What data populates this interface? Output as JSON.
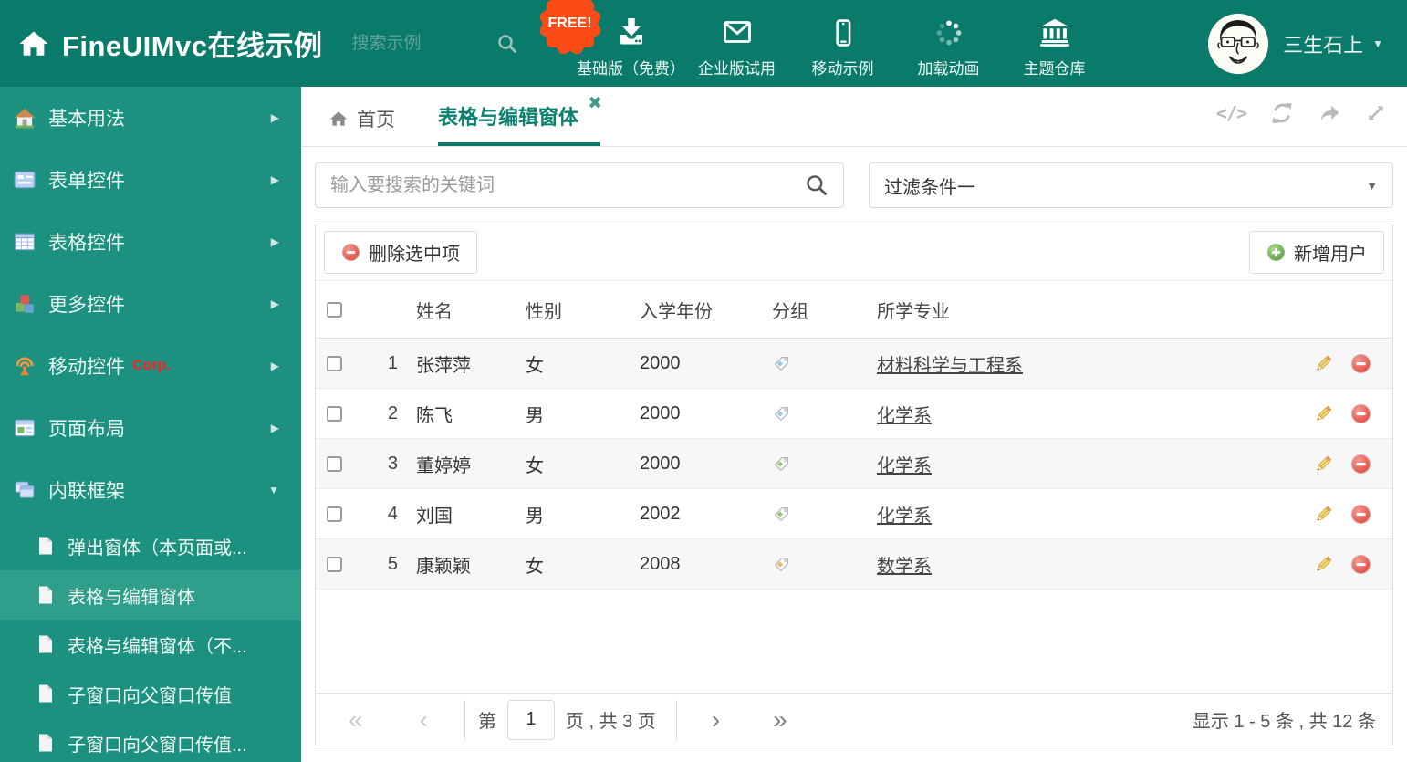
{
  "header": {
    "title": "FineUIMvc在线示例",
    "search_placeholder": "搜索示例",
    "free_badge": "FREE!",
    "nav": [
      {
        "label": "基础版（免费）",
        "icon": "download-icon"
      },
      {
        "label": "企业版试用",
        "icon": "envelope-icon"
      },
      {
        "label": "移动示例",
        "icon": "mobile-icon"
      },
      {
        "label": "加载动画",
        "icon": "spinner-icon"
      },
      {
        "label": "主题仓库",
        "icon": "bank-icon"
      }
    ],
    "user_name": "三生石上"
  },
  "sidebar": {
    "items": [
      {
        "label": "基本用法"
      },
      {
        "label": "表单控件"
      },
      {
        "label": "表格控件"
      },
      {
        "label": "更多控件"
      },
      {
        "label": "移动控件",
        "badge": "Corp."
      },
      {
        "label": "页面布局"
      },
      {
        "label": "内联框架"
      }
    ],
    "subitems": [
      {
        "label": "弹出窗体（本页面或...",
        "active": false
      },
      {
        "label": "表格与编辑窗体",
        "active": true
      },
      {
        "label": "表格与编辑窗体（不...",
        "active": false
      },
      {
        "label": "子窗口向父窗口传值",
        "active": false
      },
      {
        "label": "子窗口向父窗口传值...",
        "active": false
      }
    ]
  },
  "tabs": {
    "home_label": "首页",
    "active_label": "表格与编辑窗体"
  },
  "filter_bar": {
    "search_placeholder": "输入要搜索的关键词",
    "filter_selected": "过滤条件一"
  },
  "panel_toolbar": {
    "delete_selected_label": "删除选中项",
    "add_user_label": "新增用户"
  },
  "table": {
    "columns": {
      "name": "姓名",
      "gender": "性别",
      "year": "入学年份",
      "group": "分组",
      "major": "所学专业"
    },
    "rows": [
      {
        "num": "1",
        "name": "张萍萍",
        "gender": "女",
        "year": "2000",
        "tag_color": "#8cc8f0",
        "major": "材料科学与工程系"
      },
      {
        "num": "2",
        "name": "陈飞",
        "gender": "男",
        "year": "2000",
        "tag_color": "#8cc8f0",
        "major": "化学系"
      },
      {
        "num": "3",
        "name": "董婷婷",
        "gender": "女",
        "year": "2000",
        "tag_color": "#97c96e",
        "major": "化学系"
      },
      {
        "num": "4",
        "name": "刘国",
        "gender": "男",
        "year": "2002",
        "tag_color": "#97c96e",
        "major": "化学系"
      },
      {
        "num": "5",
        "name": "康颖颖",
        "gender": "女",
        "year": "2008",
        "tag_color": "#f6b26f",
        "major": "数学系"
      }
    ]
  },
  "pagination": {
    "first": "«",
    "prev": "‹",
    "next": "›",
    "last": "»",
    "prefix": "第",
    "page_value": "1",
    "suffix": "页 , 共 3 页",
    "summary": "显示 1 - 5 条 , 共 12 条"
  },
  "colors": {
    "header_bg": "#0a7b6b",
    "sidebar_bg": "#1d9180",
    "sidebar_active_bg": "#2f9e8b",
    "accent_teal": "#0d8070",
    "free_badge_bg": "#fb4b17",
    "corp_badge": "#ff1f1f",
    "tag_blue": "#8cc8f0",
    "tag_green": "#97c96e",
    "tag_orange": "#f6b26f",
    "delete_red": "#e04b41",
    "add_green": "#57a345",
    "edit_pencil_yellow": "#f7da7b"
  }
}
